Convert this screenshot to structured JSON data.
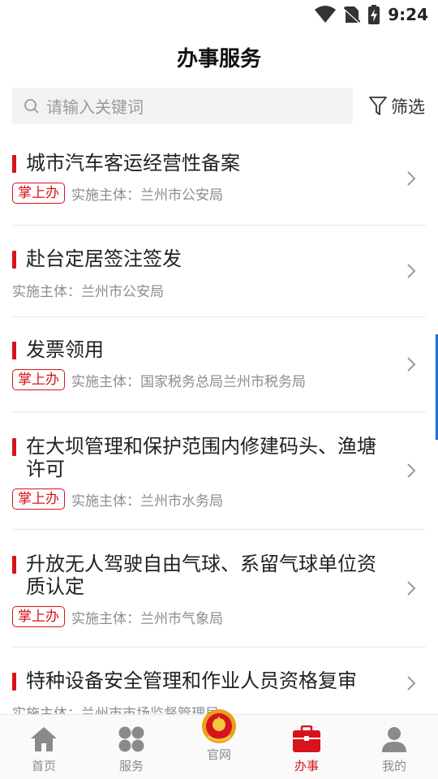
{
  "status_bar": {
    "time": "9:24",
    "icons": [
      "wifi-icon",
      "no-sim-icon",
      "battery-charging-icon"
    ]
  },
  "header": {
    "title": "办事服务"
  },
  "search": {
    "placeholder": "请输入关键词",
    "icon": "search-icon"
  },
  "filter": {
    "label": "筛选",
    "icon": "filter-icon"
  },
  "colors": {
    "accent": "#d7131b",
    "meta": "#8d8d8d",
    "scroll_indicator": "#1e6fd9"
  },
  "services": [
    {
      "title": "城市汽车客运经营性备案",
      "tag": "掌上办",
      "subject": "实施主体：兰州市公安局"
    },
    {
      "title": "赴台定居签注签发",
      "tag": "",
      "subject": "实施主体：兰州市公安局"
    },
    {
      "title": "发票领用",
      "tag": "掌上办",
      "subject": "实施主体：国家税务总局兰州市税务局"
    },
    {
      "title": "在大坝管理和保护范围内修建码头、渔塘许可",
      "tag": "掌上办",
      "subject": "实施主体：兰州市水务局"
    },
    {
      "title": "升放无人驾驶自由气球、系留气球单位资质认定",
      "tag": "掌上办",
      "subject": "实施主体：兰州市气象局"
    },
    {
      "title": "特种设备安全管理和作业人员资格复审",
      "tag": "",
      "subject": "实施主体：兰州市市场监督管理局"
    }
  ],
  "tabbar": {
    "items": [
      {
        "label": "首页",
        "icon": "home-icon"
      },
      {
        "label": "服务",
        "icon": "grid-icon"
      },
      {
        "label": "官网",
        "icon": "national-emblem-icon"
      },
      {
        "label": "办事",
        "icon": "briefcase-icon",
        "active": true
      },
      {
        "label": "我的",
        "icon": "user-icon"
      }
    ]
  }
}
